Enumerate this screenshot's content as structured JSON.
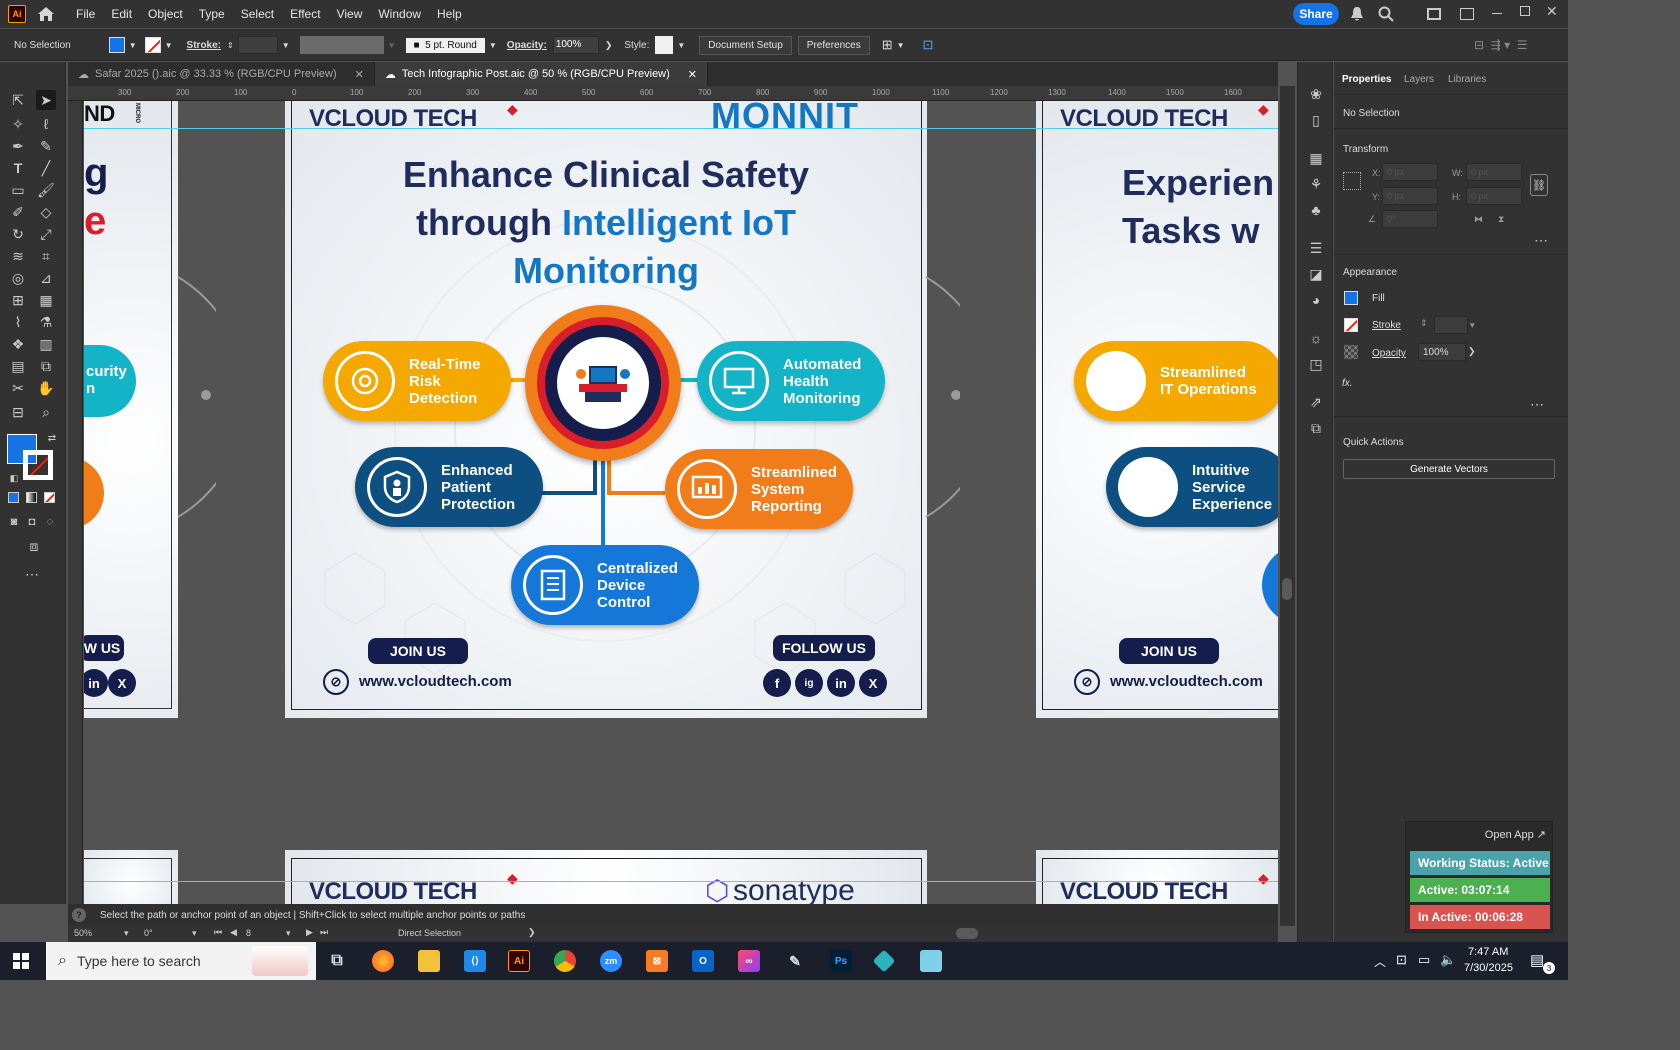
{
  "app": {
    "logo": "Ai",
    "share_label": "Share"
  },
  "menu": [
    "File",
    "Edit",
    "Object",
    "Type",
    "Select",
    "Effect",
    "View",
    "Window",
    "Help"
  ],
  "control_bar": {
    "selection": "No Selection",
    "stroke_label": "Stroke:",
    "brush": "5 pt. Round",
    "opacity_label": "Opacity:",
    "opacity_value": "100%",
    "style_label": "Style:",
    "document_setup": "Document Setup",
    "preferences": "Preferences"
  },
  "tabs": [
    {
      "label": "Safar 2025 ().aic @ 33.33 % (RGB/CPU Preview)",
      "active": false
    },
    {
      "label": "Tech Infographic Post.aic @ 50 % (RGB/CPU Preview)",
      "active": true
    }
  ],
  "ruler_top": [
    "300",
    "200",
    "100",
    "0",
    "100",
    "200",
    "300",
    "400",
    "500",
    "600",
    "700",
    "800",
    "900",
    "1000",
    "1100",
    "1200",
    "1300",
    "1400",
    "1500",
    "1600"
  ],
  "artboard_main": {
    "brand_left": "VCLOUD TECH",
    "brand_right": "MONNIT",
    "title_line1": "Enhance Clinical Safety",
    "title_line2_a": "through ",
    "title_line2_b": "Intelligent IoT",
    "title_line3": "Monitoring",
    "pills": [
      {
        "label": "Real-Time\nRisk\nDetection",
        "color": "#f5a800",
        "icon": "target-icon"
      },
      {
        "label": "Automated\nHealth\nMonitoring",
        "color": "#14b4c8",
        "icon": "monitor-icon"
      },
      {
        "label": "Enhanced\nPatient\nProtection",
        "color": "#0d4f80",
        "icon": "shield-icon"
      },
      {
        "label": "Streamlined\nSystem\nReporting",
        "color": "#f07c1a",
        "icon": "report-icon"
      },
      {
        "label": "Centralized\nDevice\nControl",
        "color": "#1577d8",
        "icon": "device-icon"
      }
    ],
    "join": "JOIN US",
    "follow": "FOLLOW US",
    "url": "www.vcloudtech.com",
    "socials": [
      "f",
      "ig",
      "in",
      "X"
    ]
  },
  "artboard_left": {
    "brand_partial": "ND",
    "brand_micro": "MICRO",
    "title_partial": "g",
    "title_red": "e",
    "pill_partial": "curity\nn",
    "follow_partial": "W US",
    "socials": [
      "in",
      "X"
    ]
  },
  "artboard_right": {
    "brand": "VCLOUD TECH",
    "title_line1": "Experien",
    "title_line2": "Tasks w",
    "pills": [
      {
        "label": "Streamlined\nIT Operations",
        "color": "#f5a800"
      },
      {
        "label": "Intuitive\nService\nExperience",
        "color": "#0d4f80"
      }
    ],
    "join": "JOIN US",
    "url": "www.vcloudtech.com"
  },
  "artboard_bottom": {
    "brand": "VCLOUD TECH",
    "partner": "sonatype"
  },
  "panel": {
    "tabs": [
      "Properties",
      "Layers",
      "Libraries"
    ],
    "selection": "No Selection",
    "transform": "Transform",
    "x_label": "X:",
    "y_label": "Y:",
    "w_label": "W:",
    "h_label": "H:",
    "x_value": "0 px",
    "y_value": "0 px",
    "w_value": "0 px",
    "h_value": "0 px",
    "angle_value": "0°",
    "appearance": "Appearance",
    "fill": "Fill",
    "stroke": "Stroke",
    "opacity": "Opacity",
    "opacity_value": "100%",
    "fx": "fx.",
    "quick_actions": "Quick Actions",
    "generate_vectors": "Generate Vectors"
  },
  "status": {
    "hint": "Select the path or anchor point of an object  |  Shift+Click to select multiple anchor points or paths",
    "zoom": "50%",
    "rotation": "0°",
    "artboard_num": "8",
    "tool": "Direct Selection"
  },
  "work_status": {
    "open_app": "Open App ↗",
    "working": "Working Status: Active",
    "active": "Active: 03:07:14",
    "inactive": "In Active: 00:06:28"
  },
  "taskbar": {
    "search_placeholder": "Type here to search",
    "time": "7:47 AM",
    "date": "7/30/2025",
    "notif_count": "3"
  },
  "colors": {
    "accent": "#1473e6",
    "navy": "#141d4b",
    "title_blue": "#1577c4",
    "active_green": "#4caf50",
    "inactive_red": "#d9534f",
    "working_teal": "#4aa3a8"
  }
}
